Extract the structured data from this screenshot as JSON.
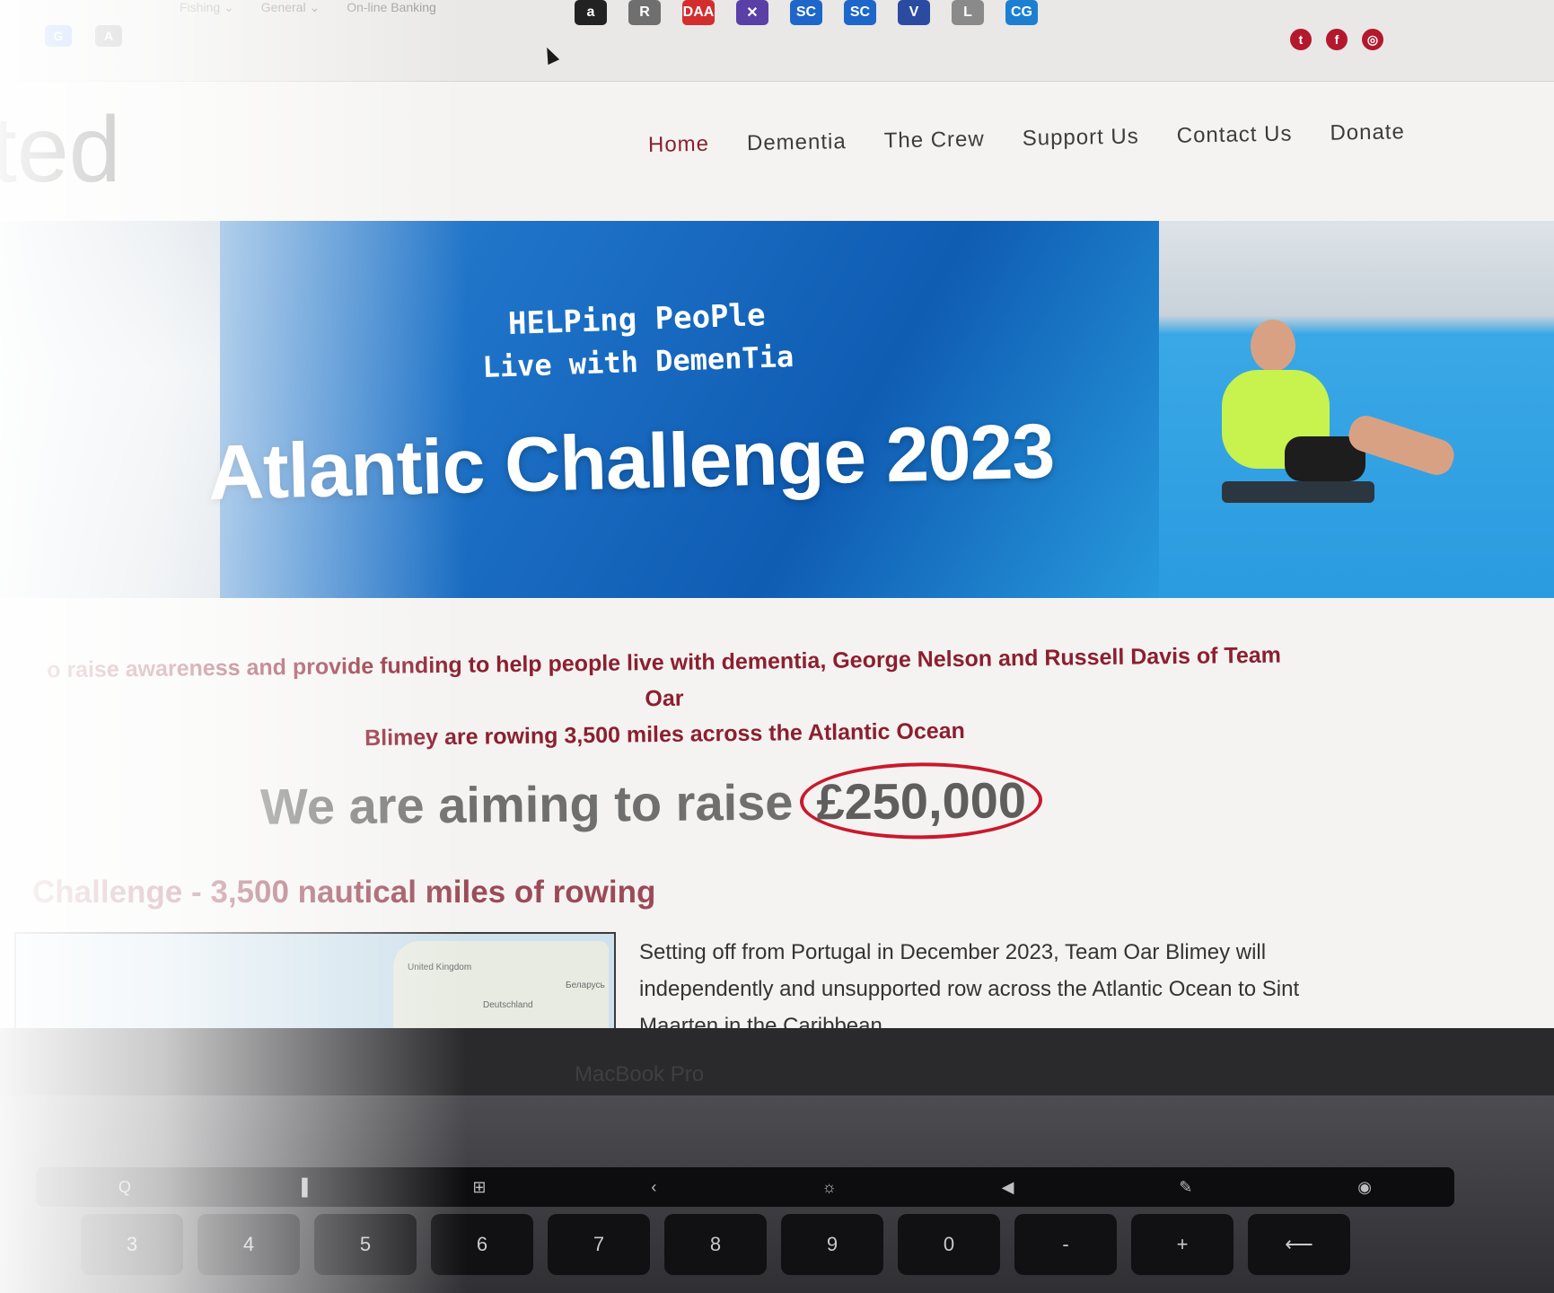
{
  "bookmarks": {
    "folders": [
      "Fishing ⌄",
      "General ⌄",
      "On-line Banking"
    ],
    "favicons_row1": [
      {
        "icon": "a",
        "name": "amazon-icon",
        "color": "#222222"
      },
      {
        "icon": "R",
        "name": "r-icon",
        "color": "#6f6f6f"
      },
      {
        "icon": "DAA",
        "name": "daa-icon",
        "color": "#d22e2e"
      },
      {
        "icon": "✕",
        "name": "x-box-icon",
        "color": "#5a3fa6"
      },
      {
        "icon": "SC",
        "name": "sc-icon-1",
        "color": "#1e66c9"
      },
      {
        "icon": "SC",
        "name": "sc-icon-2",
        "color": "#1e66c9"
      },
      {
        "icon": "V",
        "name": "v-icon",
        "color": "#2b4ba0"
      },
      {
        "icon": "L",
        "name": "l-icon",
        "color": "#8a8a8a"
      },
      {
        "icon": "CG",
        "name": "cg-icon",
        "color": "#1c7fd1"
      }
    ],
    "favicons_row2": [
      {
        "icon": "G",
        "name": "google-icon",
        "color": "#4285f4"
      },
      {
        "icon": "A",
        "name": "a-icon",
        "color": "#8a8a8a"
      }
    ]
  },
  "social": {
    "twitter": "t",
    "facebook": "f",
    "instagram": "◎"
  },
  "overlay_text": "ted",
  "nav": {
    "items": [
      {
        "label": "Home",
        "active": true
      },
      {
        "label": "Dementia"
      },
      {
        "label": "The Crew"
      },
      {
        "label": "Support Us"
      },
      {
        "label": "Contact Us"
      },
      {
        "label": "Donate"
      }
    ]
  },
  "hero": {
    "tagline_line1": "HELPing PeoPle",
    "tagline_line2": "Live with DemenTia",
    "title": "Atlantic Challenge 2023"
  },
  "intro": {
    "text_line1": "o raise awareness and provide funding to help people live with dementia, George Nelson and Russell Davis of Team Oar",
    "text_line2": "Blimey are rowing 3,500 miles across the Atlantic Ocean"
  },
  "aim": {
    "prefix": "We are aiming to raise",
    "amount": "£250,000"
  },
  "challenge": {
    "heading": "Challenge - 3,500 nautical miles of rowing"
  },
  "map": {
    "labels": [
      "United Kingdom",
      "Deutschland",
      "Беларусь"
    ]
  },
  "setting": {
    "text": "Setting off from Portugal in December 2023, Team Oar Blimey will independently and unsupported row across the Atlantic Ocean to Sint Maarten in the Caribbean."
  },
  "laptop": {
    "brand": "MacBook Pro",
    "touchbar": [
      "Q",
      "▐",
      "⊞",
      "‹",
      "☼",
      "◀",
      "✎",
      "◉"
    ],
    "keys": [
      "3",
      "4",
      "5",
      "6",
      "7",
      "8",
      "9",
      "0",
      "-",
      "+",
      "⟵"
    ]
  }
}
